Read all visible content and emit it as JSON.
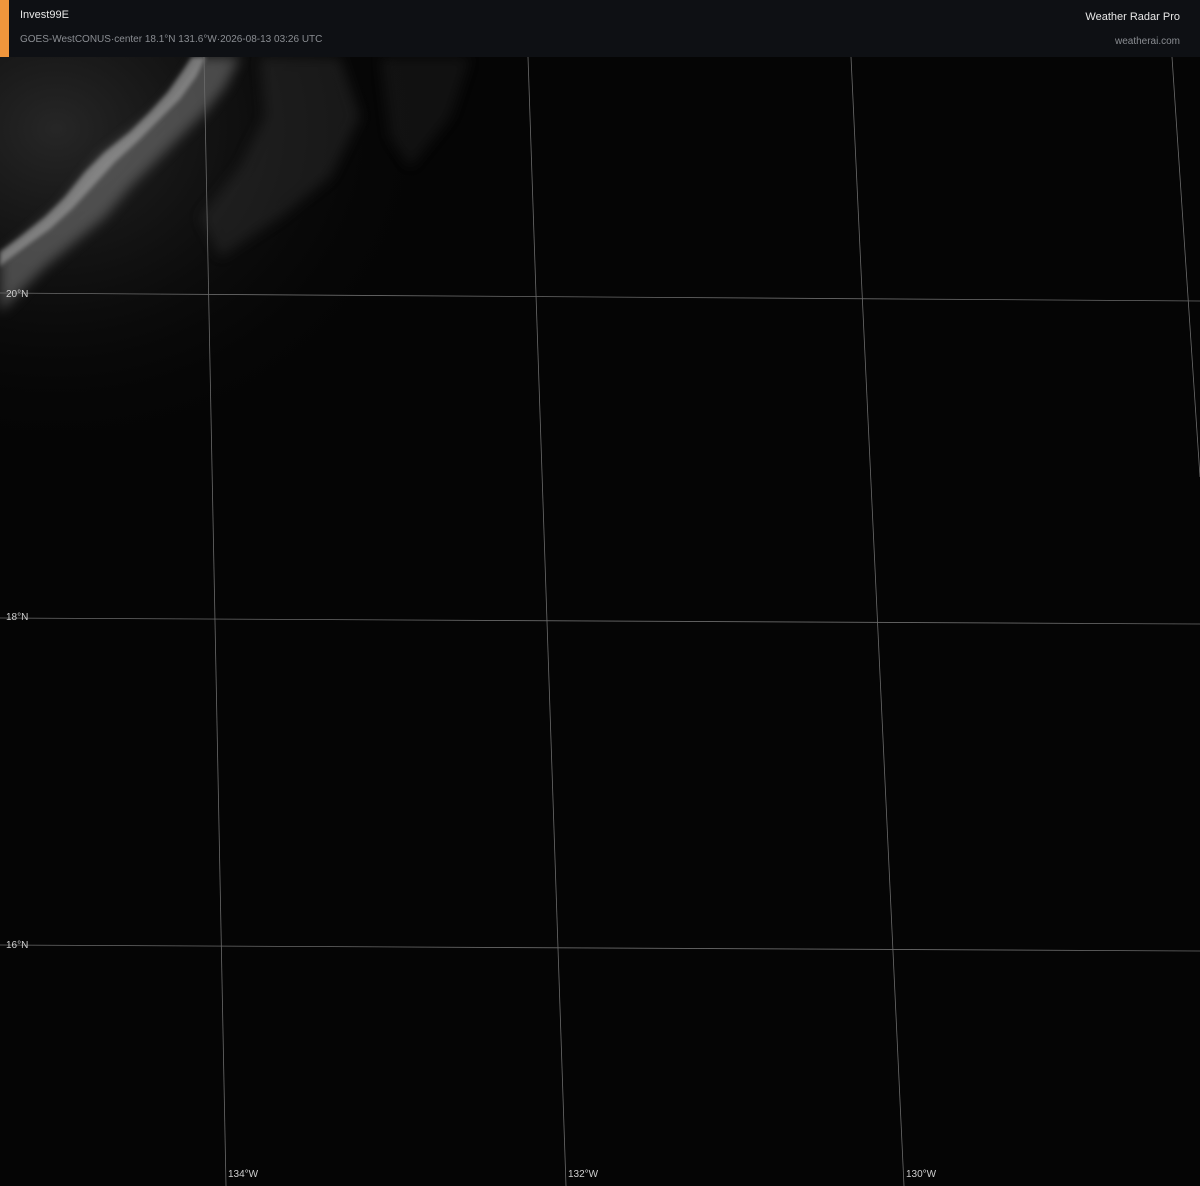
{
  "header": {
    "storm_name": "Invest99E",
    "subtitle": "GOES-WestCONUS·center 18.1°N 131.6°W·2026-08-13 03:26 UTC",
    "brand": "Weather Radar Pro",
    "site": "weatherai.com",
    "accent_color": "#f0963c"
  },
  "map": {
    "latitude_labels": [
      "20°N",
      "18°N",
      "16°N"
    ],
    "longitude_labels": [
      "134°W",
      "132°W",
      "130°W"
    ],
    "grid_color": "#6b6b6b",
    "background_color": "#050505"
  }
}
